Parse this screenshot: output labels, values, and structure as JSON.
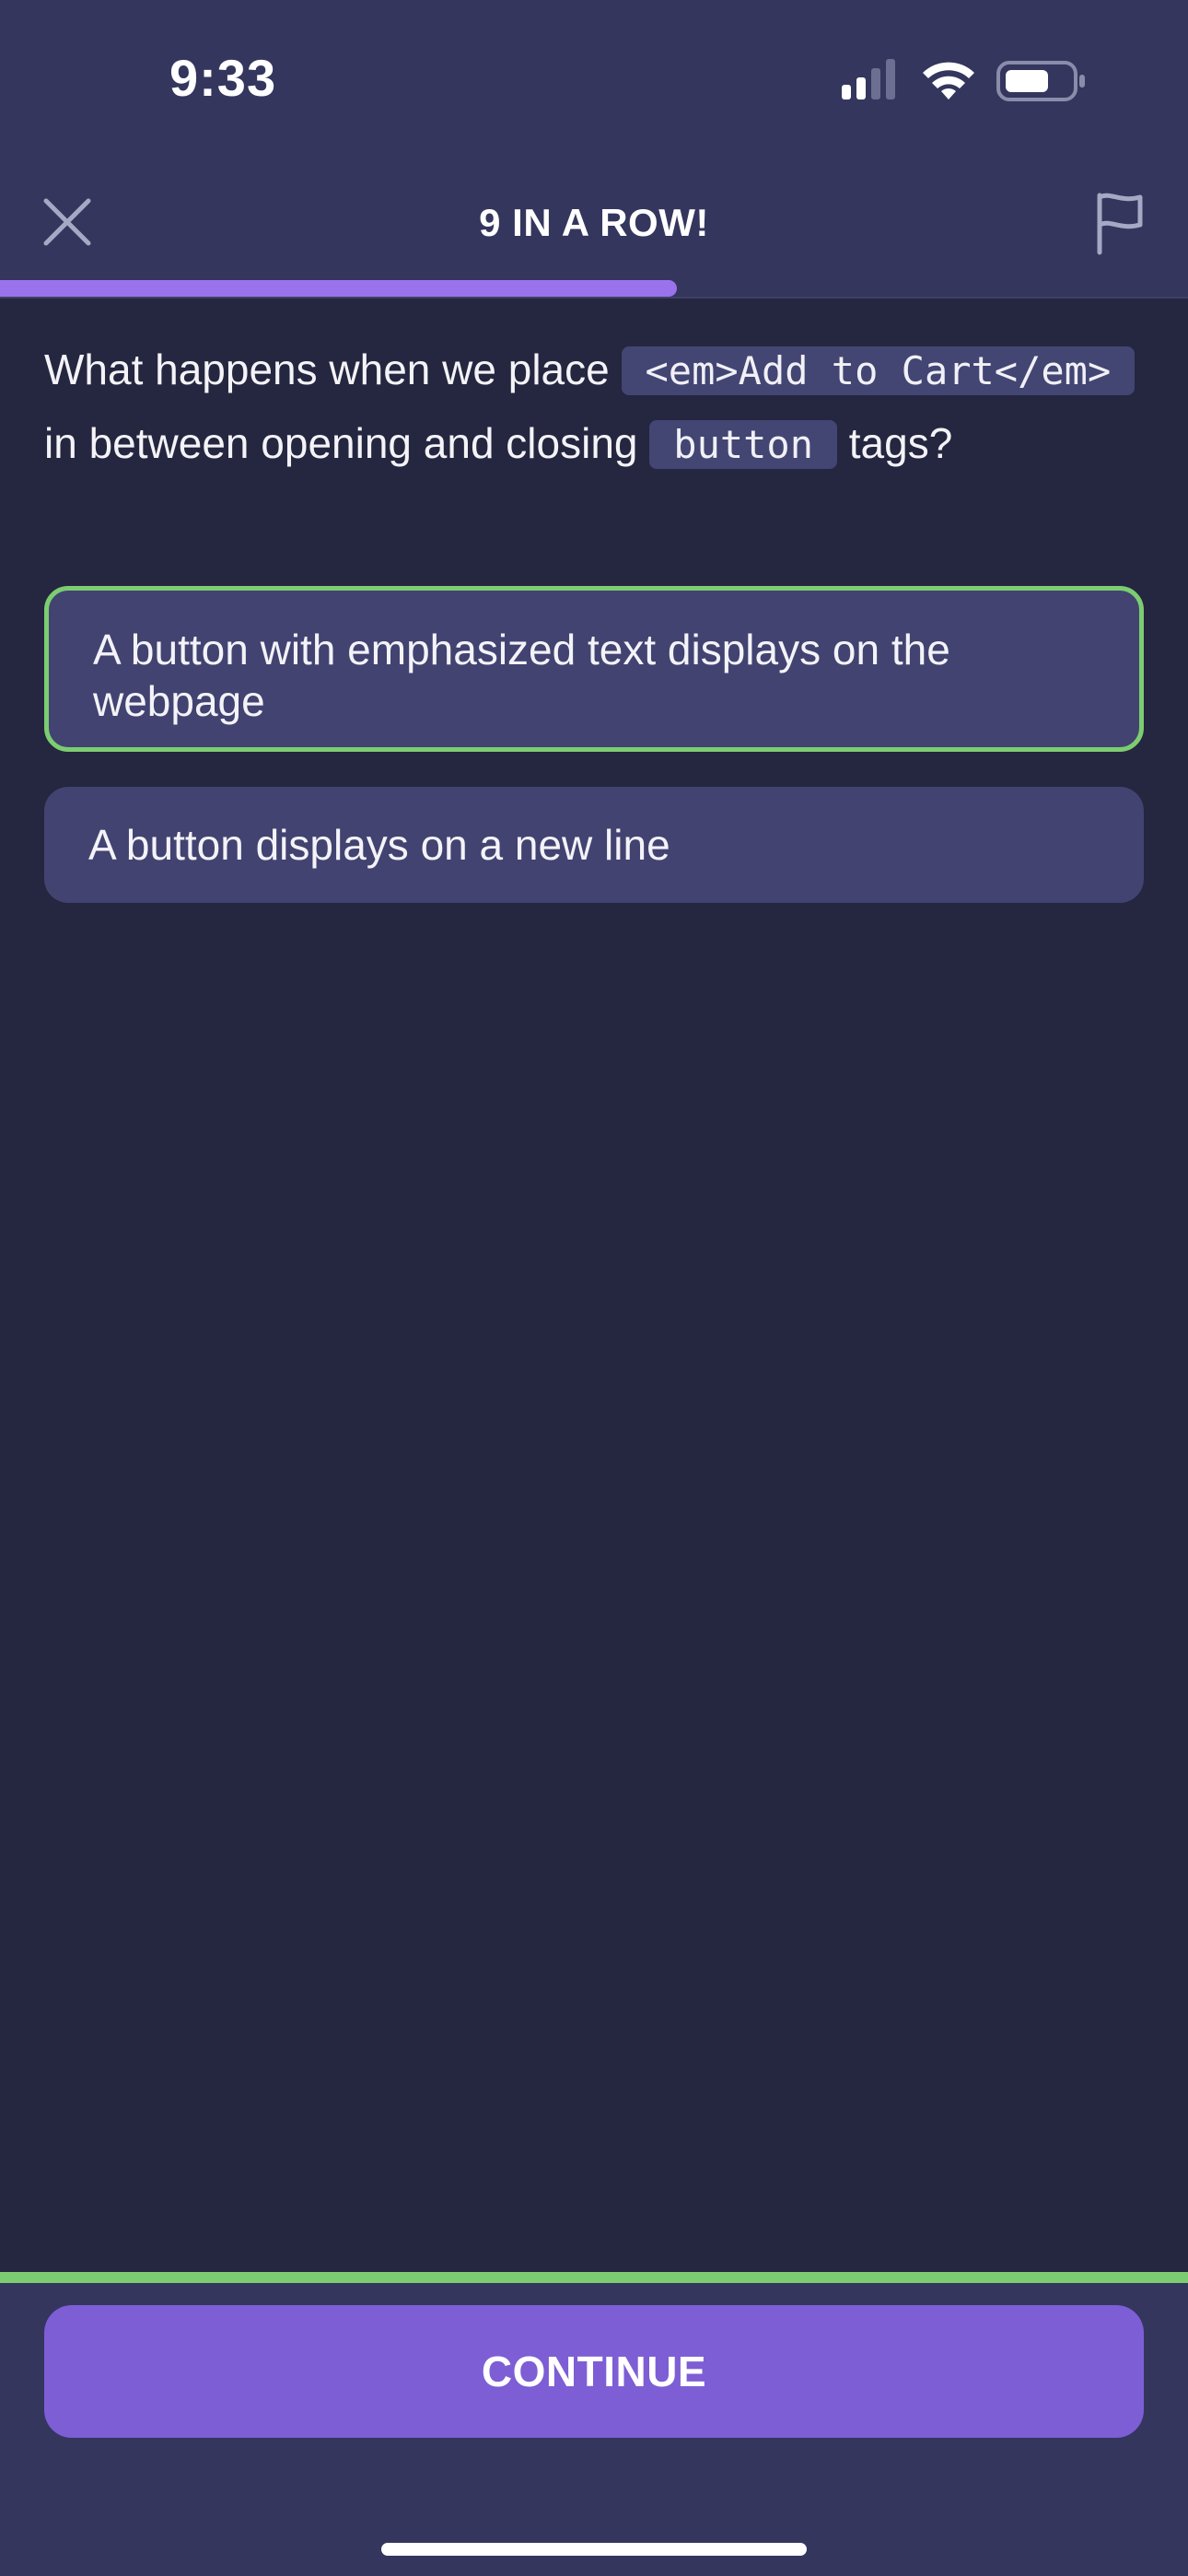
{
  "status_bar": {
    "time": "9:33"
  },
  "header": {
    "title": "9 IN A ROW!",
    "progress_fraction": 0.57
  },
  "question": {
    "part1": "What happens when we place ",
    "code1": "<em>Add to Cart</em>",
    "part2": " in between opening and closing ",
    "code2": "button",
    "part3": " tags?"
  },
  "answers": [
    {
      "label": "A button with emphasized text displays on the webpage",
      "selected": true
    },
    {
      "label": "A button displays on a new line",
      "selected": false
    }
  ],
  "footer": {
    "continue_label": "CONTINUE"
  },
  "colors": {
    "background": "#25263f",
    "header_bg": "#34365e",
    "accent_purple": "#7d5ed5",
    "progress": "#9a73ec",
    "correct_green": "#7ccd71",
    "answer_bg": "#424371"
  },
  "icons": [
    "close-icon",
    "flag-icon",
    "signal-icon",
    "wifi-icon",
    "battery-icon"
  ]
}
